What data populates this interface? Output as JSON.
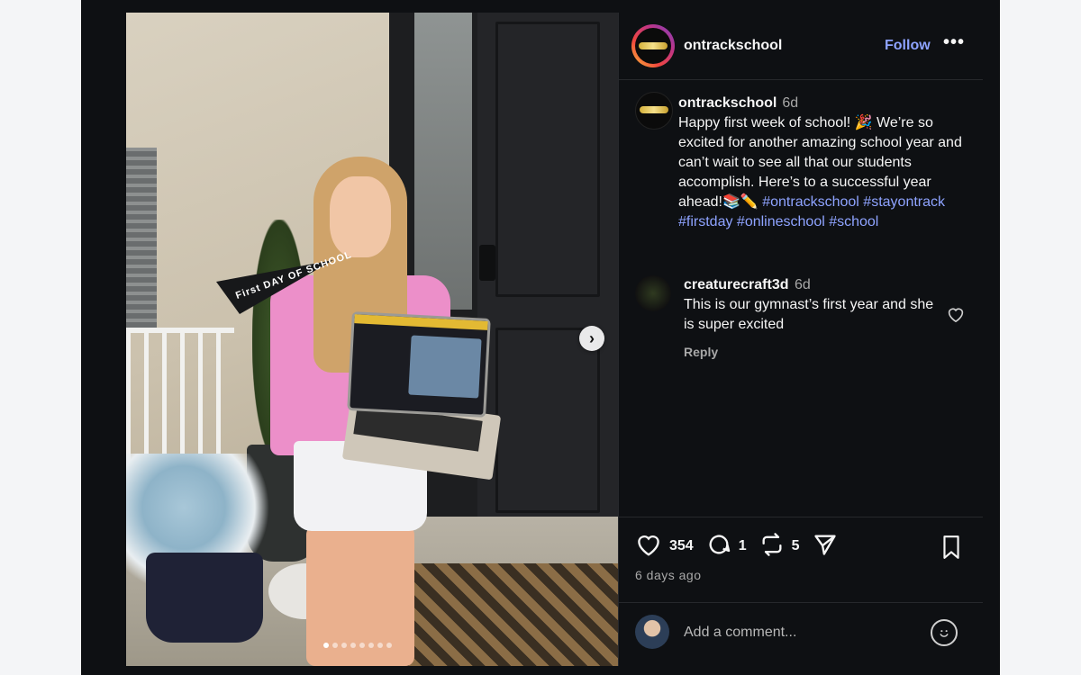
{
  "post": {
    "username": "ontrackschool",
    "follow_label": "Follow",
    "more_label": "•••",
    "caption_user": "ontrackschool",
    "caption_age": "6d",
    "caption_text": "Happy first week of school! 🎉 We’re so excited for another amazing school year and can’t wait to see all that our students accomplish. Here’s to a successful year ahead!📚✏️",
    "caption_tags": "#ontrackschool #stayontrack #firstday #onlineschool #school",
    "pennant_text": "First DAY OF SCHOOL"
  },
  "comment": {
    "username": "creaturecraft3d",
    "age": "6d",
    "text": "This is our gymnast’s first year and she is super excited",
    "reply_label": "Reply",
    "like_icon": "heart-outline-icon"
  },
  "actions": {
    "likes": "354",
    "comments": "1",
    "reposts": "5",
    "time_ago": "6 days ago"
  },
  "composer": {
    "placeholder": "Add a comment..."
  },
  "carousel": {
    "next_symbol": "›",
    "dot_count": 8,
    "active_dot": 0
  },
  "colors": {
    "panel_bg": "#0e1013",
    "link_blue": "#8ea3ff",
    "muted": "#a8a8a8"
  }
}
